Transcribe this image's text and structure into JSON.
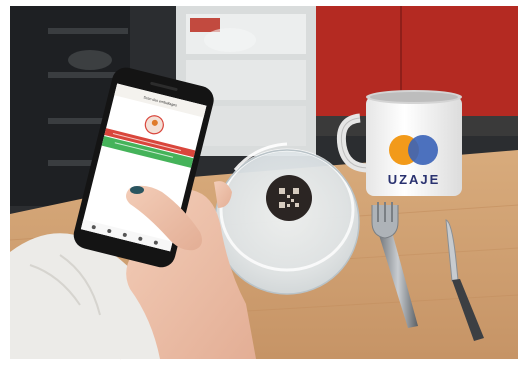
{
  "photo": {
    "mug_brand_text": "UZAJE",
    "phone_screen": {
      "header_title": "Scan des emballages",
      "alert_banner_text": "",
      "confirm_banner_text": ""
    }
  },
  "colors": {
    "phone_header_bg": "#f4f2ee",
    "banner_red": "#d9463c",
    "banner_green": "#45b35a",
    "mug_orange": "#f29a1a",
    "mug_blue": "#3a63b8",
    "mug_text": "#2a3270"
  }
}
